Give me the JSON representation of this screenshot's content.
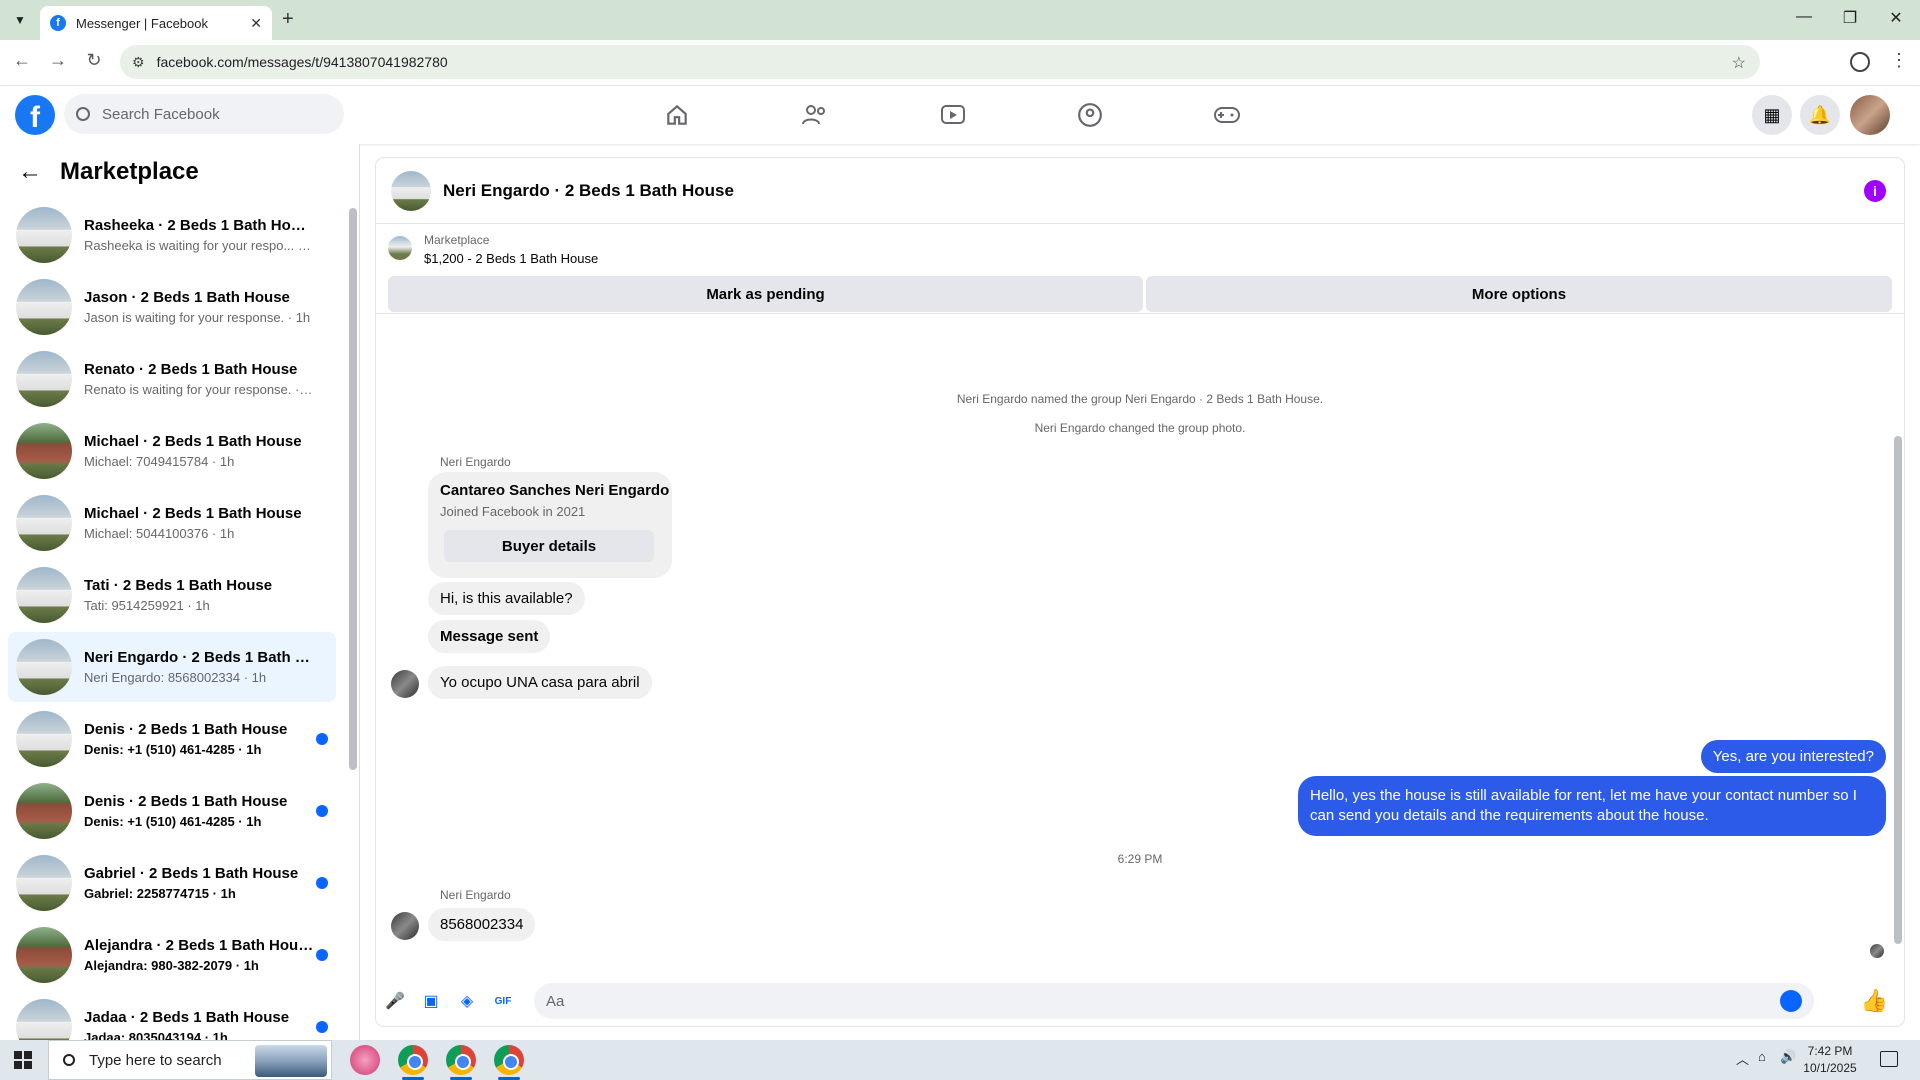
{
  "browser": {
    "tab_title": "Messenger | Facebook",
    "url": "facebook.com/messages/t/9413807041982780"
  },
  "fb": {
    "search_placeholder": "Search Facebook"
  },
  "sidebar": {
    "title": "Marketplace",
    "conversations": [
      {
        "name": "Rasheeka · 2 Beds 1 Bath House",
        "preview": "Rasheeka is waiting for your respo... · 1h",
        "unread": false,
        "photo": "white"
      },
      {
        "name": "Jason · 2 Beds 1 Bath House",
        "preview": "Jason is waiting for your response. · 1h",
        "unread": false,
        "photo": "white"
      },
      {
        "name": "Renato · 2 Beds 1 Bath House",
        "preview": "Renato is waiting for your response. · 1h",
        "unread": false,
        "photo": "white"
      },
      {
        "name": "Michael · 2 Beds 1 Bath House",
        "preview": "Michael: 7049415784 · 1h",
        "unread": false,
        "photo": "brick"
      },
      {
        "name": "Michael · 2 Beds 1 Bath House",
        "preview": "Michael: 5044100376 · 1h",
        "unread": false,
        "photo": "white"
      },
      {
        "name": "Tati · 2 Beds 1 Bath House",
        "preview": "Tati: 9514259921 · 1h",
        "unread": false,
        "photo": "white"
      },
      {
        "name": "Neri Engardo · 2 Beds 1 Bath Ho...",
        "preview": "Neri Engardo: 8568002334 · 1h",
        "unread": false,
        "photo": "white",
        "active": true
      },
      {
        "name": "Denis · 2 Beds 1 Bath House",
        "preview": "Denis: +1 (510) 461-4285 · 1h",
        "unread": true,
        "photo": "white"
      },
      {
        "name": "Denis · 2 Beds 1 Bath House",
        "preview": "Denis: +1 (510) 461-4285 · 1h",
        "unread": true,
        "photo": "brick"
      },
      {
        "name": "Gabriel · 2 Beds 1 Bath House",
        "preview": "Gabriel: 2258774715 · 1h",
        "unread": true,
        "photo": "white"
      },
      {
        "name": "Alejandra · 2 Beds 1 Bath House",
        "preview": "Alejandra: 980-382-2079 · 1h",
        "unread": true,
        "photo": "brick"
      },
      {
        "name": "Jadaa · 2 Beds 1 Bath House",
        "preview": "Jadaa: 8035043194 · 1h",
        "unread": true,
        "photo": "white"
      }
    ]
  },
  "chat": {
    "title": "Neri Engardo · 2 Beds 1 Bath House",
    "marketplace_label": "Marketplace",
    "listing": "$1,200 - 2 Beds 1 Bath House",
    "mark_pending": "Mark as pending",
    "more_options": "More options",
    "sys1": "Neri Engardo named the group Neri Engardo · 2 Beds 1 Bath House.",
    "sys2": "Neri Engardo changed the group photo.",
    "sender": "Neri Engardo",
    "card_name": "Cantareo Sanches Neri Engardo",
    "card_joined": "Joined Facebook in 2021",
    "card_button": "Buyer details",
    "msg1": "Hi, is this available?",
    "msg2": "Message sent",
    "msg3": "Yo ocupo UNA casa para abril",
    "out1": "Yes, are you interested?",
    "out2a": "Hello, yes the house is still available for rent, let me have your contact number so I",
    "out2b": "can send you details and the requirements about the house.",
    "time": "6:29 PM",
    "msg4": "8568002334",
    "composer_placeholder": "Aa"
  },
  "taskbar": {
    "search": "Type here to search",
    "time": "7:42 PM",
    "date": "10/1/2025"
  }
}
